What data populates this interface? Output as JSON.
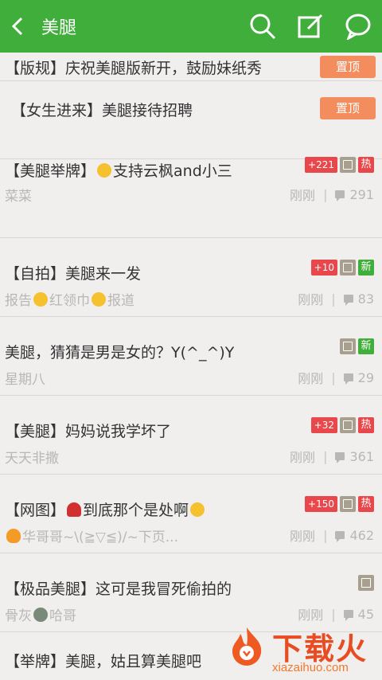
{
  "topbar": {
    "title": "美腿",
    "icons": [
      "back-arrow-icon",
      "search-icon",
      "compose-icon",
      "chat-bubble-icon"
    ]
  },
  "colors": {
    "brand_green": "#3fae3a",
    "pin_orange": "#f48d5e",
    "hot_red": "#e8474b"
  },
  "posts": [
    {
      "title": "【版规】庆祝美腿版新开，鼓励妹纸秀",
      "pin": "置顶"
    },
    {
      "title": "【女生进来】美腿接待招聘",
      "pin": "置顶"
    },
    {
      "title_a": "【美腿举牌】",
      "title_b": "支持云枫and小三",
      "count": "+221",
      "hot": "热",
      "author": "菜菜",
      "time": "刚刚",
      "comments": "291"
    },
    {
      "title": "【自拍】美腿来一发",
      "count": "+10",
      "new": "新",
      "author_a": "报告",
      "author_b": "红领巾",
      "author_c": "报道",
      "time": "刚刚",
      "comments": "83"
    },
    {
      "title": "美腿，猜猜是男是女的？Y(^_^)Y",
      "new": "新",
      "author": "星期八",
      "time": "刚刚",
      "comments": "29"
    },
    {
      "title": "【美腿】妈妈说我学坏了",
      "count": "+32",
      "hot": "热",
      "author": "天天非撒",
      "time": "刚刚",
      "comments": "361"
    },
    {
      "title_a": "【网图】",
      "title_b": "到底那个是处啊",
      "count": "+150",
      "hot": "热",
      "author": "华哥哥~\\(≧▽≦)/~下页...",
      "time": "刚刚",
      "comments": "462"
    },
    {
      "title": "【极品美腿】这可是我冒死偷拍的",
      "author_a": "骨灰",
      "author_b": "哈哥",
      "time": "刚刚",
      "comments": "45"
    },
    {
      "title": "【举牌】美腿，姑且算美腿吧"
    }
  ],
  "watermark": {
    "text": "下载火",
    "url": "xiazaihuo.com"
  }
}
